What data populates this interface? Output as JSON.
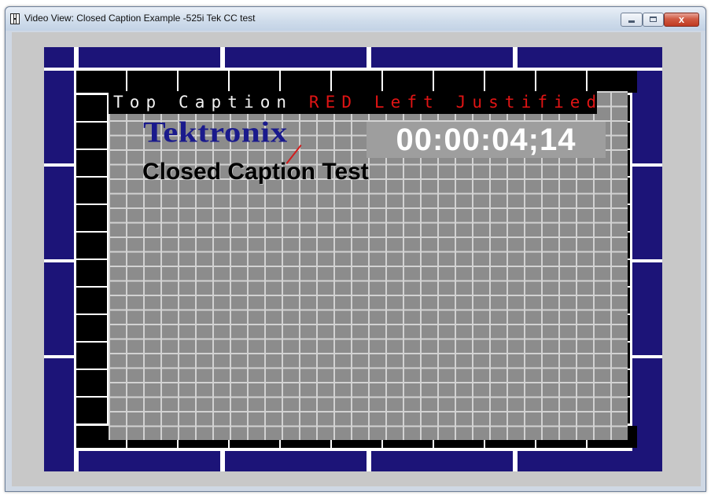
{
  "window": {
    "title": "Video View: Closed Caption Example -525i Tek CC test",
    "close_glyph": "x"
  },
  "icons": {
    "app": "film-strip-icon",
    "minimize": "minimize-icon",
    "maximize": "maximize-icon",
    "close": "close-icon"
  },
  "video": {
    "caption_prefix": "Top Caption ",
    "caption_highlight": "RED Left Justified",
    "logo": "Tektronix",
    "timecode": "00:00:04;14",
    "test_label": "Closed Caption Test",
    "colors": {
      "border_blue": "#1c1478",
      "pattern_black": "#000000",
      "grid_gray": "#8c8c8c",
      "caption_red": "#e01414",
      "logo_blue": "#1a1a8c"
    }
  }
}
